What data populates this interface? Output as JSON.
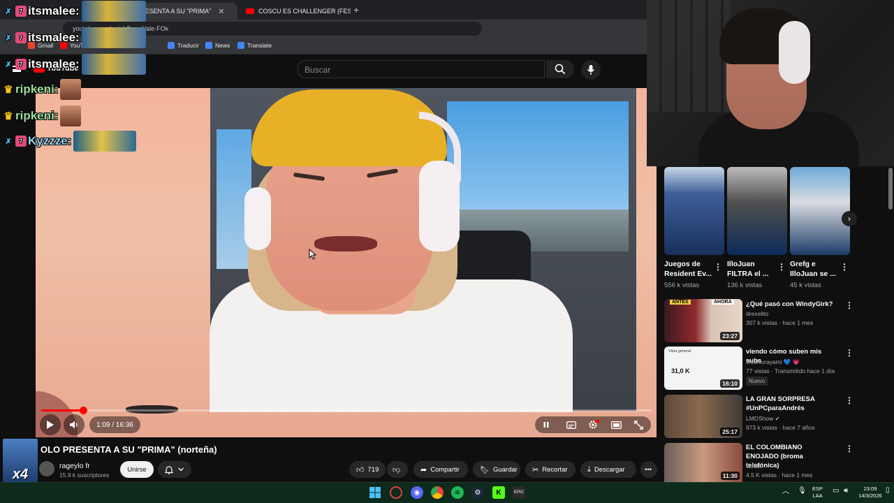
{
  "browser": {
    "tabs": [
      {
        "label": "...O PRESENTA A SU \"PRIMA\"",
        "close": "✕"
      },
      {
        "label": "COSCU ES CHALLENGER (FESTI",
        "close": "✕"
      }
    ],
    "new_tab": "+",
    "url": "youtube.com/watch?v=...Vale-FOk",
    "bookmarks": [
      "Gmail",
      "YouTube",
      "Traducir",
      "News",
      "Translate"
    ]
  },
  "youtube": {
    "logo": "YouTube",
    "search_placeholder": "Buscar"
  },
  "chat": [
    {
      "user": "itsmalee:",
      "badge": "7"
    },
    {
      "user": "itsmalee:",
      "badge": "7"
    },
    {
      "user": "itsmalee:",
      "badge": "7"
    },
    {
      "user": "ripkeni:",
      "badge": "crown"
    },
    {
      "user": "ripkeni:",
      "badge": "crown"
    },
    {
      "user": "Kyzzze:",
      "badge": "7"
    }
  ],
  "player": {
    "time": "1:09 / 16:36",
    "progress_fraction": 0.069
  },
  "video": {
    "title": "OLO PRESENTA A SU \"PRIMA\" (norteña)",
    "channel": "rageylo fr",
    "subscribers": "15.9 k suscriptores",
    "join_label": "Unirse",
    "likes": "719",
    "share_label": "Compartir",
    "save_label": "Guardar",
    "clip_label": "Recortar",
    "download_label": "Descargar",
    "overlay_multiplier": "x4"
  },
  "shorts": [
    {
      "title": "Juegos de Resident Ev...",
      "views": "556 k vistas"
    },
    {
      "title": "IlloJuan FILTRA el ...",
      "views": "136 k vistas"
    },
    {
      "title": "Grefg e IlloJuan se ...",
      "views": "45 k vistas"
    }
  ],
  "sidebar_videos": [
    {
      "title": "¿Qué pasó con WindyGirk?",
      "channel": "drexelito",
      "meta": "307 k vistas · hace 1 mes",
      "duration": "23:27",
      "badge": "",
      "thumb_labels": [
        "ANTES",
        "AHORA"
      ]
    },
    {
      "title": "viendo cómo suben mis subs",
      "channel": "OsuKurayami 💙 💗",
      "meta": "77 vistas · Transmitido hace 1 día",
      "duration": "16:10",
      "badge": "Nuevo",
      "thumb_labels": [
        "Vista general",
        "31,0 K"
      ]
    },
    {
      "title": "LA GRAN SORPRESA #UnPCparaAndrés",
      "channel": "LMDShow ✔",
      "meta": "973 k vistas · hace 7 años",
      "duration": "25:17",
      "badge": "",
      "thumb_labels": []
    },
    {
      "title": "EL COLOMBIANO ENOJADO (broma telefónica)",
      "channel": "Cufas",
      "meta": "4.5 K vistas · hace 1 mes",
      "duration": "11:30",
      "badge": "",
      "thumb_labels": []
    }
  ],
  "taskbar": {
    "lang_top": "ESP",
    "lang_bottom": "LAA",
    "time": "23:09",
    "date": "14/3/2026"
  }
}
